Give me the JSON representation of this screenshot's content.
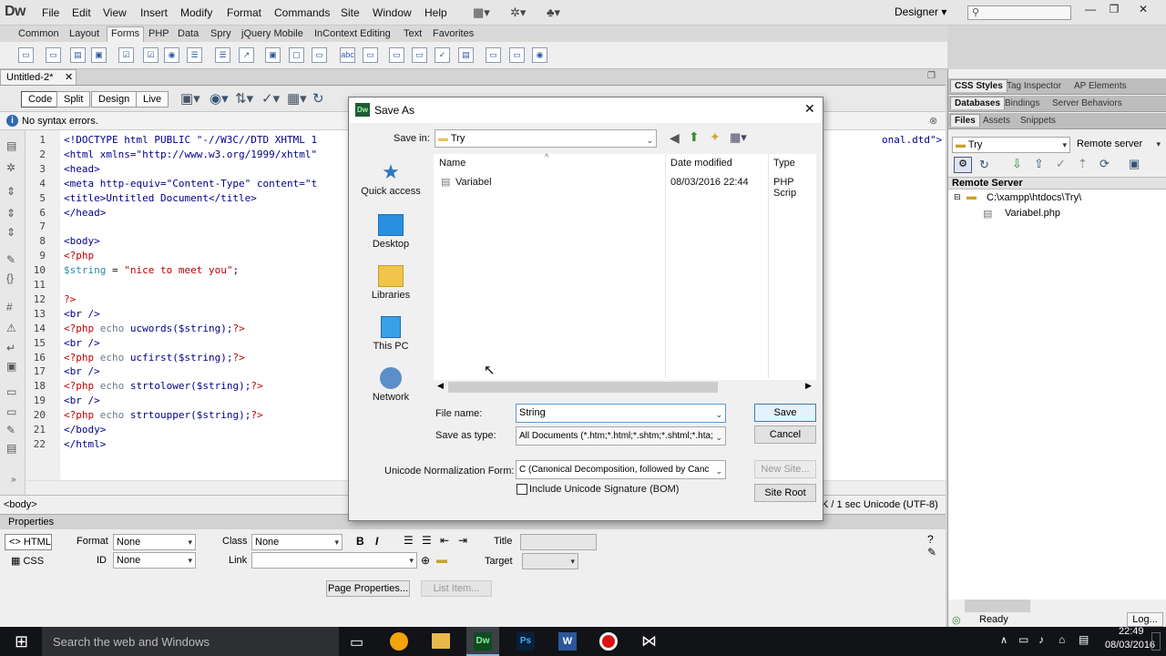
{
  "app": {
    "logo": "Dw",
    "menu": [
      "File",
      "Edit",
      "View",
      "Insert",
      "Modify",
      "Format",
      "Commands",
      "Site",
      "Window",
      "Help"
    ],
    "workspace": "Designer",
    "search_placeholder": ""
  },
  "insert_tabs": [
    "Common",
    "Layout",
    "Forms",
    "PHP",
    "Data",
    "Spry",
    "jQuery Mobile",
    "InContext Editing",
    "Text",
    "Favorites"
  ],
  "document": {
    "tab": "Untitled-2*",
    "views": [
      "Code",
      "Split",
      "Design",
      "Live"
    ],
    "syntax_status": "No syntax errors.",
    "line_numbers": [
      "1",
      "2",
      "3",
      "4",
      "5",
      "6",
      "7",
      "8",
      "9",
      "10",
      "11",
      "12",
      "13",
      "14",
      "15",
      "16",
      "17",
      "18",
      "19",
      "20",
      "21",
      "22"
    ],
    "code_lines": [
      "<!DOCTYPE html PUBLIC \"-//W3C//DTD XHTML 1",
      "<html xmlns=\"http://www.w3.org/1999/xhtml\"",
      "<head>",
      "<meta http-equiv=\"Content-Type\" content=\"t",
      "<title>Untitled Document</title>",
      "</head>",
      "",
      "<body>",
      "<?php",
      "$string = \"nice to meet you\";",
      "",
      "?>",
      "<br />",
      "<?php echo ucwords($string);?>",
      "<br />",
      "<?php echo ucfirst($string);?>",
      "<br />",
      "<?php echo strtolower($string);?>",
      "<br />",
      "<?php echo strtoupper($string);?>",
      "</body>",
      "</html>"
    ],
    "code_line1_tail": "onal.dtd\">",
    "status_tag": "<body>",
    "status_right": "K / 1 sec  Unicode (UTF-8)"
  },
  "properties": {
    "title": "Properties",
    "html_btn": "<> HTML",
    "css_btn": "CSS",
    "format_label": "Format",
    "format_value": "None",
    "id_label": "ID",
    "id_value": "None",
    "class_label": "Class",
    "class_value": "None",
    "link_label": "Link",
    "title_label": "Title",
    "target_label": "Target",
    "page_props": "Page Properties...",
    "list_item": "List Item..."
  },
  "right_panel": {
    "tabs_row1": [
      "CSS Styles",
      "Tag Inspector",
      "AP Elements"
    ],
    "tabs_row2": [
      "Databases",
      "Bindings",
      "Server Behaviors"
    ],
    "tabs_row3": [
      "Files",
      "Assets",
      "Snippets"
    ],
    "site": "Try",
    "server": "Remote server",
    "header": "Remote Server",
    "path": "C:\\xampp\\htdocs\\Try\\",
    "file": "Variabel.php",
    "status": "Ready",
    "log": "Log..."
  },
  "dialog": {
    "title": "Save As",
    "save_in_label": "Save in:",
    "save_in_value": "Try",
    "quick_access": [
      "Quick access",
      "Desktop",
      "Libraries",
      "This PC",
      "Network"
    ],
    "columns": [
      "Name",
      "Date modified",
      "Type"
    ],
    "files": [
      {
        "name": "Variabel",
        "date": "08/03/2016 22:44",
        "type": "PHP Scrip"
      }
    ],
    "file_name_label": "File name:",
    "file_name_value": "String",
    "save_type_label": "Save as type:",
    "save_type_value": "All Documents (*.htm;*.html;*.shtm;*.shtml;*.hta;",
    "unicode_label": "Unicode Normalization Form:",
    "unicode_value": "C (Canonical Decomposition, followed by Canc",
    "bom_label": "Include Unicode Signature (BOM)",
    "save_btn": "Save",
    "cancel_btn": "Cancel",
    "new_site_btn": "New Site...",
    "site_root_btn": "Site Root"
  },
  "taskbar": {
    "search": "Search the web and Windows",
    "time": "22:49",
    "date": "08/03/2016"
  }
}
